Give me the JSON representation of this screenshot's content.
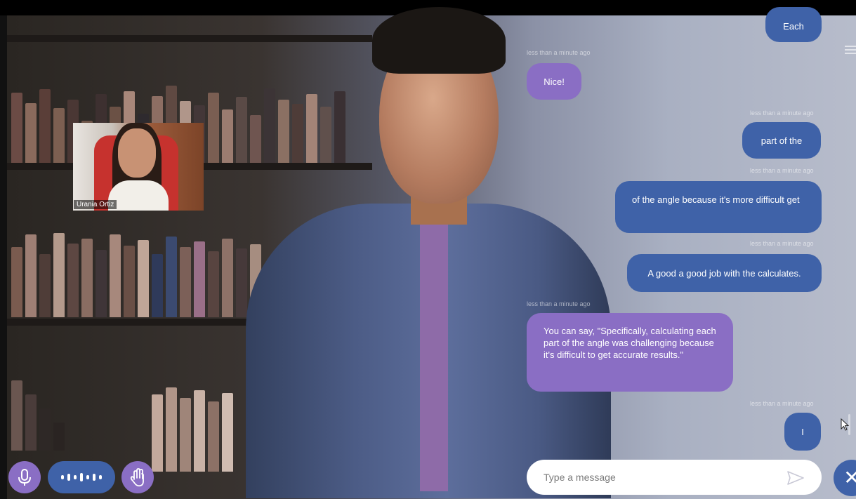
{
  "video_tile": {
    "participant_name": "Urania Ortiz"
  },
  "chat": {
    "messages": [
      {
        "role": "user",
        "text": "Each",
        "timestamp": ""
      },
      {
        "role": "bot",
        "text": "Nice!",
        "timestamp": "less than a minute ago"
      },
      {
        "role": "user",
        "text": "part of the",
        "timestamp": "less than a minute ago"
      },
      {
        "role": "user",
        "text": "of the angle because it's more difficult get",
        "timestamp": "less than a minute ago"
      },
      {
        "role": "user",
        "text": "A good a good job with the calculates.",
        "timestamp": "less than a minute ago"
      },
      {
        "role": "bot",
        "text": "You can say, \"Specifically, calculating each part of the angle was challenging because it's difficult to get accurate results.\"",
        "timestamp": "less than a minute ago"
      },
      {
        "role": "user",
        "text": "I",
        "timestamp": "less than a minute ago"
      }
    ]
  },
  "input": {
    "placeholder": "Type a message"
  },
  "controls": {
    "mic_icon": "microphone-icon",
    "waves_icon": "audio-waves-icon",
    "hand_icon": "raise-hand-icon",
    "send_icon": "send-icon",
    "close_icon": "close-icon",
    "close_label": "✕"
  },
  "colors": {
    "user_bubble": "#3f62a8",
    "bot_bubble": "#8a6ec4"
  }
}
